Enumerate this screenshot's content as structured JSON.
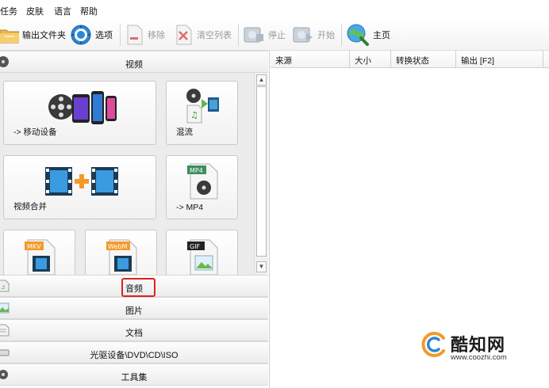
{
  "menu": {
    "items": [
      {
        "label": "任务"
      },
      {
        "label": "皮肤"
      },
      {
        "label": "语言"
      },
      {
        "label": "帮助"
      }
    ]
  },
  "toolbar": {
    "output_folder": "输出文件夹",
    "options": "选项",
    "remove": "移除",
    "clear_list": "清空列表",
    "stop": "停止",
    "start": "开始",
    "home": "主页"
  },
  "left": {
    "video_category": "视频",
    "tiles": {
      "mobile": "-> 移动设备",
      "mux": "混流",
      "merge": "视频合并",
      "mp4": "-> MP4",
      "mp4_badge": "MP4",
      "mkv_badge": "MKV",
      "webm_badge": "WebM",
      "gif_badge": "GIF"
    },
    "categories": {
      "audio": "音频",
      "image": "图片",
      "document": "文档",
      "rom": "光驱设备\\DVD\\CD\\ISO",
      "tools": "工具集"
    }
  },
  "right": {
    "columns": [
      "来源",
      "大小",
      "转换状态",
      "输出 [F2]"
    ]
  },
  "watermark": {
    "name": "酷知网",
    "url": "www.coozhi.com"
  },
  "colors": {
    "highlight": "#e02020",
    "accent_orange": "#f39a2a"
  }
}
